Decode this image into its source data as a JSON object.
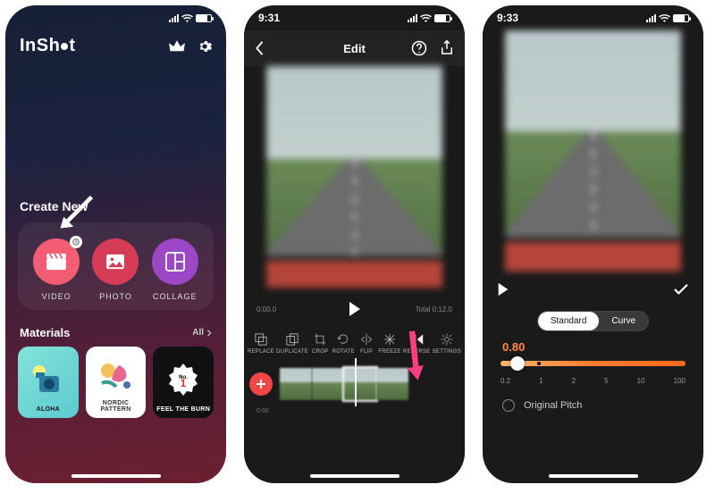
{
  "phone1": {
    "status": {
      "time": ""
    },
    "logo": "InShOt",
    "create_title": "Create New",
    "tiles": [
      {
        "label": "VIDEO"
      },
      {
        "label": "PHOTO"
      },
      {
        "label": "COLLAGE"
      }
    ],
    "materials_title": "Materials",
    "materials_all": "All",
    "materials": [
      {
        "label": "ALOHA"
      },
      {
        "label": "NORDIC PATTERN"
      },
      {
        "label": "FEEL THE BURN"
      }
    ]
  },
  "phone2": {
    "status": {
      "time": "9:31"
    },
    "title": "Edit",
    "play_time": "0:00.0",
    "total_time": "Total 0:12.0",
    "tools": [
      {
        "label": "REPLACE"
      },
      {
        "label": "DUPLICATE"
      },
      {
        "label": "CROP"
      },
      {
        "label": "ROTATE"
      },
      {
        "label": "FLIP"
      },
      {
        "label": "FREEZE"
      },
      {
        "label": "REVERSE"
      },
      {
        "label": "SETTINGS"
      }
    ],
    "timeline_time": "0:00"
  },
  "phone3": {
    "status": {
      "time": "9:33"
    },
    "segments": {
      "standard": "Standard",
      "curve": "Curve"
    },
    "speed_value": "0.80",
    "ticks": [
      "0.2",
      "1",
      "2",
      "5",
      "10",
      "100"
    ],
    "original_pitch": "Original Pitch"
  }
}
